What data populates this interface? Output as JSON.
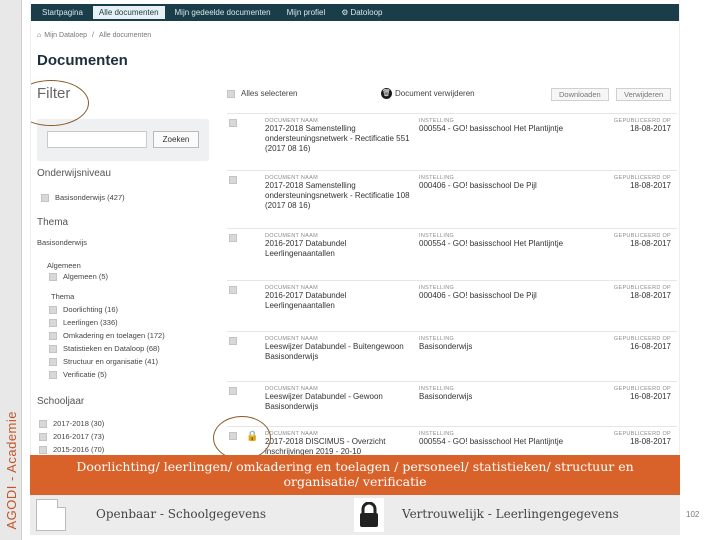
{
  "side_label": "AGODI - Academie",
  "topnav": {
    "items": [
      {
        "label": "Startpagina",
        "active": false
      },
      {
        "label": "Alle documenten",
        "active": true
      },
      {
        "label": "Mijn gedeelde documenten",
        "active": false
      },
      {
        "label": "Mijn profiel",
        "active": false
      },
      {
        "label": "Datoloop",
        "active": false,
        "icon": "gear-icon"
      }
    ]
  },
  "breadcrumb": {
    "home": "Mijn Dataloep",
    "current": "Alle documenten"
  },
  "page_title": "Documenten",
  "filter": {
    "title": "Filter",
    "search_button": "Zoeken",
    "search_value": "",
    "onderwijsniveau": {
      "title": "Onderwijsniveau",
      "items": [
        {
          "label": "Basisonderwijs (427)"
        }
      ]
    },
    "thema": {
      "title": "Thema",
      "sub": "Basisonderwijs",
      "group1": "Algemeen",
      "algemeen": "Algemeen (5)",
      "group2": "Thema",
      "items": [
        "Doorlichting (16)",
        "Leerlingen (336)",
        "Omkadering en toelagen (172)",
        "Statistieken en Dataloop (68)",
        "Structuur en organisatie (41)",
        "Verificatie (5)"
      ]
    },
    "schooljaar": {
      "title": "Schooljaar",
      "items": [
        "2017-2018 (30)",
        "2016-2017 (73)",
        "2015-2016 (70)"
      ]
    }
  },
  "toolbar": {
    "select_all": "Alles selecteren",
    "delete_selection": "Document verwijderen",
    "download": "Downloaden",
    "delete": "Verwijderen"
  },
  "columns": {
    "name": "DOCUMENT NAAM",
    "institution": "INSTELLING",
    "published": "GEPUBLICEERD OP"
  },
  "documents": [
    {
      "name": "2017-2018 Samenstelling ondersteuningsnetwerk - Rectificatie 551 (2017 08 16)",
      "institution": "000554 - GO! basisschool Het Plantijntje",
      "date": "18-08-2017",
      "locked": false
    },
    {
      "name": "2017-2018 Samenstelling ondersteuningsnetwerk - Rectificatie 108 (2017 08 16)",
      "institution": "000406 - GO! basisschool De Pijl",
      "date": "18-08-2017",
      "locked": false
    },
    {
      "name": "2016-2017 Databundel Leerlingenaantallen",
      "institution": "000554 - GO! basisschool Het Plantijntje",
      "date": "18-08-2017",
      "locked": false
    },
    {
      "name": "2016-2017 Databundel Leerlingenaantallen",
      "institution": "000406 - GO! basisschool De Pijl",
      "date": "18-08-2017",
      "locked": false
    },
    {
      "name": "Leeswijzer Databundel - Buitengewoon Basisonderwijs",
      "institution": "Basisonderwijs",
      "date": "16-08-2017",
      "locked": false
    },
    {
      "name": "Leeswijzer Databundel - Gewoon Basisonderwijs",
      "institution": "Basisonderwijs",
      "date": "16-08-2017",
      "locked": false
    },
    {
      "name": "2017-2018 DISCIMUS - Overzicht inschrijvingen 2019 - 20-10",
      "institution": "000554 - GO! basisschool Het Plantijntje",
      "date": "18-08-2017",
      "locked": true
    }
  ],
  "banner": {
    "line1": "Doorlichting/ leerlingen/ omkadering en toelagen / personeel/ statistieken/ structuur en",
    "line2": "organisatie/ verificatie"
  },
  "legend": {
    "public": "Openbaar - Schoolgegevens",
    "confidential": "Vertrouwelijk - Leerlingengegevens"
  },
  "page_number": "102",
  "colors": {
    "nav": "#1a3e49",
    "banner": "#d9622b",
    "side_text": "#c0562a",
    "annotation": "#8a5a2a"
  }
}
